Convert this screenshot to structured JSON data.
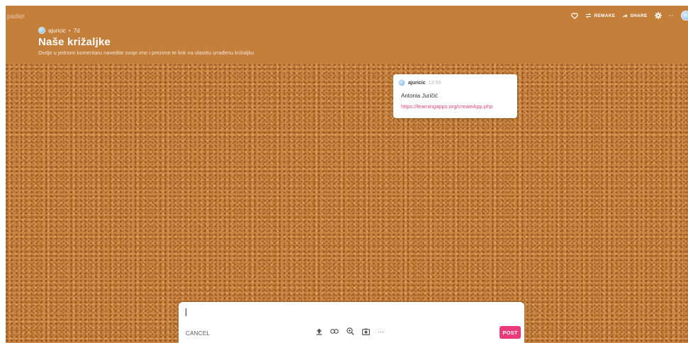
{
  "header": {
    "brand": "padlet",
    "author": "ajuricic",
    "separator": "•",
    "age": "7d",
    "title": "Naše križaljke",
    "description": "Ovdje u jednom komentaru navedite svoje ime i prezime te link na vlastitu izrađenu križaljku",
    "actions": {
      "remake_label": "REMAKE",
      "share_label": "SHARE",
      "more_label": "···"
    }
  },
  "post": {
    "author": "ajuricic",
    "time": "13:59",
    "name": "Antonia Juričić",
    "link": "https://learningapps.org/createApp.php"
  },
  "composer": {
    "cancel_label": "CANCEL",
    "more_label": "···",
    "post_label": "POST"
  },
  "colors": {
    "header_bg": "#c47f3b",
    "cork_bg": "#c98642",
    "link": "#e0457b",
    "post_button": "#ea3a7a"
  },
  "icons": {
    "heart": "heart-icon",
    "remake": "remake-icon",
    "share": "share-icon",
    "settings": "gear-icon",
    "upload": "upload-icon",
    "link": "link-icon",
    "search": "search-image-icon",
    "camera": "camera-icon"
  }
}
